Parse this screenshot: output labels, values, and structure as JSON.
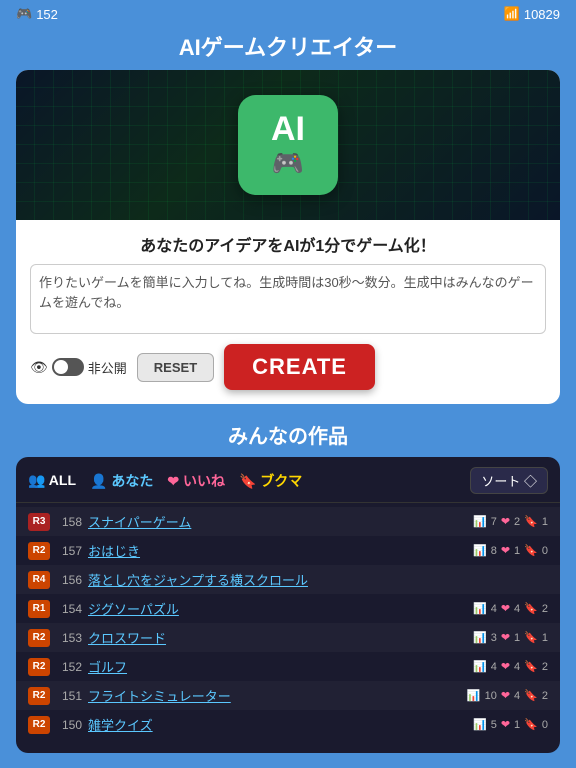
{
  "statusBar": {
    "leftIcon": "🎮",
    "leftValue": "152",
    "rightIcon": "📶",
    "rightValue": "10829"
  },
  "pageTitle": "AIゲームクリエイター",
  "heroSubtitle": "あなたのアイデアをAIが1分でゲーム化！",
  "inputPlaceholder": "作りたいゲームを簡単に入力してね。生成時間は30秒〜数分。生成中はみんなのゲームを遊んでね。",
  "privateLabel": "非公開",
  "resetLabel": "RESET",
  "createLabel": "CREATE",
  "sectionTitle": "みんなの作品",
  "filterTabs": [
    {
      "label": "👥 ALL",
      "active": true,
      "style": "active"
    },
    {
      "label": "👤 あなた",
      "active": false,
      "style": "blue"
    },
    {
      "label": "❤ いいね",
      "active": false,
      "style": "pink"
    },
    {
      "label": "🔖 ブクマ",
      "active": false,
      "style": "gold"
    }
  ],
  "sortLabel": "ソート ◇",
  "games": [
    {
      "rank": "R3",
      "number": 158,
      "title": "スナイパーゲーム",
      "bar": 7,
      "heart": 2,
      "bookmark": 1
    },
    {
      "rank": "R2",
      "number": 157,
      "title": "おはじき",
      "bar": 8,
      "heart": 1,
      "bookmark": 0
    },
    {
      "rank": "R4",
      "number": 156,
      "title": "落とし穴をジャンプする横スクロール",
      "bar": null,
      "heart": null,
      "bookmark": null
    },
    {
      "rank": "R1",
      "number": 154,
      "title": "ジグソーパズル",
      "bar": 4,
      "heart": 4,
      "bookmark": 2
    },
    {
      "rank": "R2",
      "number": 153,
      "title": "クロスワード",
      "bar": 3,
      "heart": 1,
      "bookmark": 1
    },
    {
      "rank": "R2",
      "number": 152,
      "title": "ゴルフ",
      "bar": 4,
      "heart": 4,
      "bookmark": 2
    },
    {
      "rank": "R2",
      "number": 151,
      "title": "フライトシミュレーター",
      "bar": 10,
      "heart": 4,
      "bookmark": 2
    },
    {
      "rank": "R2",
      "number": 150,
      "title": "雑学クイズ",
      "bar": 5,
      "heart": 1,
      "bookmark": 0
    }
  ]
}
